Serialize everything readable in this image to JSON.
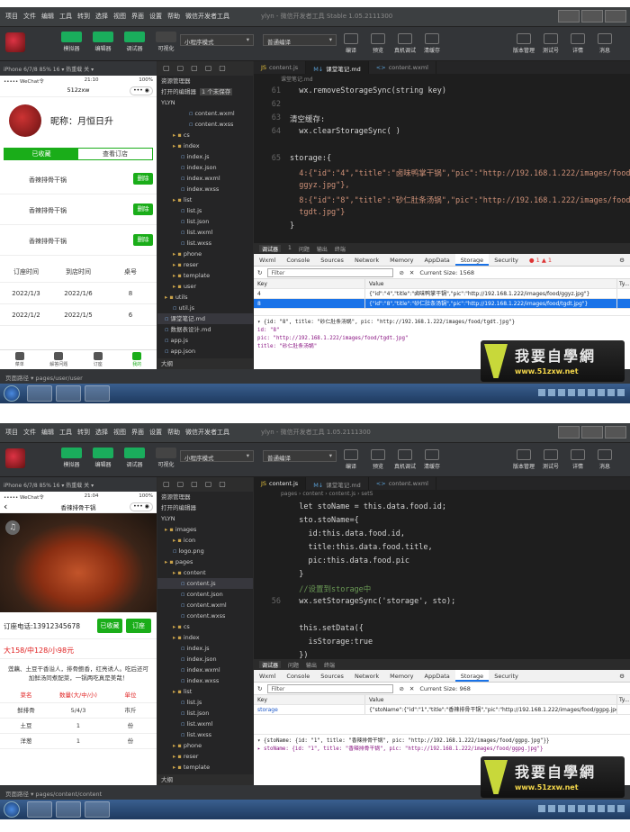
{
  "menu": [
    "项目",
    "文件",
    "编辑",
    "工具",
    "转到",
    "选择",
    "视图",
    "界面",
    "设置",
    "帮助",
    "微信开发者工具"
  ],
  "toolbar": {
    "left": [
      "模拟器",
      "编辑器",
      "调试器",
      "可视化"
    ],
    "mode_select": "小程序模式",
    "compile_select": "普通编译",
    "mid": [
      "编译",
      "预览",
      "真机调试",
      "清缓存"
    ],
    "right": [
      "版本管理",
      "测试号",
      "详情",
      "消息"
    ]
  },
  "screens": [
    {
      "window_title": "ylyn - 微信开发者工具 Stable 1.05.2111300",
      "sim_header": "iPhone 6/7/8 85% 16 ▾    热重载 关 ▾",
      "phone_status": {
        "carrier": "••••• WeChat令",
        "time": "21:10",
        "battery": "100%"
      },
      "nav_title": "512zxw",
      "profile_name": "昵称：月恒日升",
      "profile_tabs": [
        "已收藏",
        "查看订店"
      ],
      "favorites": [
        {
          "name": "香辣排骨干锅",
          "action": "删除"
        },
        {
          "name": "香辣排骨干锅",
          "action": "删除"
        },
        {
          "name": "香辣排骨干锅",
          "action": "删除"
        }
      ],
      "orders_header": [
        "订座时间",
        "到店时间",
        "桌号"
      ],
      "orders": [
        [
          "2022/1/3",
          "2022/1/6",
          "8"
        ],
        [
          "2022/1/2",
          "2022/1/5",
          "6"
        ]
      ],
      "tabbar": [
        "菜单",
        "解答问题",
        "订座",
        "我的"
      ],
      "explorer_head": "资源管理器",
      "explorer_open": "打开的编辑器",
      "explorer_open_badge": "1 个未保存",
      "explorer_project": "YLYN",
      "tree": [
        {
          "name": "content.wxml",
          "indent": 3,
          "type": "file"
        },
        {
          "name": "content.wxss",
          "indent": 3,
          "type": "file"
        },
        {
          "name": "cs",
          "indent": 1,
          "type": "folder"
        },
        {
          "name": "index",
          "indent": 1,
          "type": "folder"
        },
        {
          "name": "index.js",
          "indent": 2,
          "type": "file"
        },
        {
          "name": "index.json",
          "indent": 2,
          "type": "file"
        },
        {
          "name": "index.wxml",
          "indent": 2,
          "type": "file"
        },
        {
          "name": "index.wxss",
          "indent": 2,
          "type": "file"
        },
        {
          "name": "list",
          "indent": 1,
          "type": "folder"
        },
        {
          "name": "list.js",
          "indent": 2,
          "type": "file"
        },
        {
          "name": "list.json",
          "indent": 2,
          "type": "file"
        },
        {
          "name": "list.wxml",
          "indent": 2,
          "type": "file"
        },
        {
          "name": "list.wxss",
          "indent": 2,
          "type": "file"
        },
        {
          "name": "phone",
          "indent": 1,
          "type": "folder"
        },
        {
          "name": "reser",
          "indent": 1,
          "type": "folder"
        },
        {
          "name": "template",
          "indent": 1,
          "type": "folder"
        },
        {
          "name": "user",
          "indent": 1,
          "type": "folder"
        },
        {
          "name": "utils",
          "indent": 0,
          "type": "folder"
        },
        {
          "name": "util.js",
          "indent": 1,
          "type": "file"
        },
        {
          "name": "课堂笔记.md",
          "indent": 0,
          "type": "file",
          "selected": true
        },
        {
          "name": "数据表设计.md",
          "indent": 0,
          "type": "file"
        },
        {
          "name": "app.js",
          "indent": 0,
          "type": "file"
        },
        {
          "name": "app.json",
          "indent": 0,
          "type": "file"
        }
      ],
      "outline": "大纲",
      "editor_tabs": [
        {
          "label": "content.js",
          "icon": "JS",
          "active": false
        },
        {
          "label": "课堂笔记.md",
          "icon": "M↓",
          "active": true
        },
        {
          "label": "content.wxml",
          "icon": "<>",
          "active": false
        }
      ],
      "breadcrumb": "课堂笔记.md",
      "code_start": 61,
      "code": [
        "  wx.removeStorageSync(string key)",
        "",
        "清空缓存:",
        "  wx.clearStorageSync( )",
        "",
        "storage:{",
        "  4:{\"id\":\"4\",\"title\":\"卤味鸭掌干锅\",\"pic\":\"http://192.168.1.222/images/food/",
        "  ggyz.jpg\"},",
        "  8:{\"id\":\"8\",\"title\":\"砂仁肚条汤锅\",\"pic\":\"http://192.168.1.222/images/food/",
        "  tgdt.jpg\"}",
        "}"
      ],
      "code_linenos": [
        "61",
        "62",
        "63",
        "64",
        "",
        "65",
        "",
        "",
        "",
        "",
        ""
      ],
      "dv_top": [
        "调试器",
        "1",
        "问题",
        "输出",
        "终端"
      ],
      "dv_tabs": [
        "Wxml",
        "Console",
        "Sources",
        "Network",
        "Memory",
        "AppData",
        "Storage",
        "Security"
      ],
      "dv_badges": "● 1 ▲ 1",
      "filter_placeholder": "Filter",
      "storage_size": "Current Size: 1568",
      "storage_cols": [
        "Key",
        "Value",
        "Ty..."
      ],
      "storage_rows": [
        {
          "key": "4",
          "value": "{\"id\":\"4\",\"title\":\"卤味鸭掌干锅\",\"pic\":\"http://192.168.1.222/images/food/ggyz.jpg\"}",
          "sel": false
        },
        {
          "key": "8",
          "value": "{\"id\":\"8\",\"title\":\"砂仁肚条汤锅\",\"pic\":\"http://192.168.1.222/images/food/tgdt.jpg\"}",
          "sel": true
        }
      ],
      "detail": [
        "▾ {id: \"8\", title: \"砂仁肚条汤锅\", pic: \"http://192.168.1.222/images/food/tgdt.jpg\"}",
        "    id: \"8\"",
        "    pic: \"http://192.168.1.222/images/food/tgdt.jpg\"",
        "    title: \"砂仁肚条汤锅\""
      ],
      "status_left": "页面路径 ▾    pages/user/user",
      "status_right": "行 65, 列 1    arkdown"
    },
    {
      "window_title": "ylyn - 微信开发者工具 1.05.2111300",
      "sim_header": "iPhone 6/7/8 85% 16 ▾    热重载 关 ▾",
      "phone_status": {
        "carrier": "••••• WeChat令",
        "time": "21:04",
        "battery": "100%"
      },
      "nav_title": "香辣排骨干锅",
      "order_phone": "订座电话:13912345678",
      "order_buttons": [
        "已收藏",
        "订座"
      ],
      "price": "大158/中128/小98元",
      "desc": "莲藕、土豆干香溢人，排骨鲍香，红亮诱人。吃后还可加鲜汤同煮配菜，一锅两吃真是美哉！",
      "ingr_header": [
        "菜名",
        "数量(大/中/小)",
        "单位"
      ],
      "ingr": [
        [
          "鲜排骨",
          "5/4/3",
          "市斤"
        ],
        [
          "土豆",
          "1",
          "份"
        ],
        [
          "洋葱",
          "1",
          "份"
        ]
      ],
      "explorer_head": "资源管理器",
      "explorer_open": "打开的编辑器",
      "explorer_project": "YLYN",
      "tree": [
        {
          "name": "images",
          "indent": 0,
          "type": "folder"
        },
        {
          "name": "icon",
          "indent": 1,
          "type": "folder"
        },
        {
          "name": "logo.png",
          "indent": 1,
          "type": "file"
        },
        {
          "name": "pages",
          "indent": 0,
          "type": "folder"
        },
        {
          "name": "content",
          "indent": 1,
          "type": "folder"
        },
        {
          "name": "content.js",
          "indent": 2,
          "type": "file",
          "selected": true
        },
        {
          "name": "content.json",
          "indent": 2,
          "type": "file"
        },
        {
          "name": "content.wxml",
          "indent": 2,
          "type": "file"
        },
        {
          "name": "content.wxss",
          "indent": 2,
          "type": "file"
        },
        {
          "name": "cs",
          "indent": 1,
          "type": "folder"
        },
        {
          "name": "index",
          "indent": 1,
          "type": "folder"
        },
        {
          "name": "index.js",
          "indent": 2,
          "type": "file"
        },
        {
          "name": "index.json",
          "indent": 2,
          "type": "file"
        },
        {
          "name": "index.wxml",
          "indent": 2,
          "type": "file"
        },
        {
          "name": "index.wxss",
          "indent": 2,
          "type": "file"
        },
        {
          "name": "list",
          "indent": 1,
          "type": "folder"
        },
        {
          "name": "list.js",
          "indent": 2,
          "type": "file"
        },
        {
          "name": "list.json",
          "indent": 2,
          "type": "file"
        },
        {
          "name": "list.wxml",
          "indent": 2,
          "type": "file"
        },
        {
          "name": "list.wxss",
          "indent": 2,
          "type": "file"
        },
        {
          "name": "phone",
          "indent": 1,
          "type": "folder"
        },
        {
          "name": "reser",
          "indent": 1,
          "type": "folder"
        },
        {
          "name": "template",
          "indent": 1,
          "type": "folder"
        }
      ],
      "outline": "大纲",
      "editor_tabs": [
        {
          "label": "content.js",
          "icon": "JS",
          "active": true
        },
        {
          "label": "课堂笔记.md",
          "icon": "M↓",
          "active": false
        },
        {
          "label": "content.wxml",
          "icon": "<>",
          "active": false
        }
      ],
      "breadcrumb": "pages › content › content.js › setS",
      "code_start": 51,
      "code": [
        "  let stoName = this.data.food.id;",
        "  sto.stoName={",
        "    id:this.data.food.id,",
        "    title:this.data.food.title,",
        "    pic:this.data.food.pic",
        "  }",
        "  //设置到storage中",
        "  wx.setStorageSync('storage', sto);",
        "",
        "  this.setData({",
        "    isStorage:true",
        "  })",
        "},",
        "",
        "/**"
      ],
      "code_linenos": [
        "",
        "",
        "",
        "",
        "",
        "",
        "",
        "56",
        "",
        "",
        "",
        "",
        "",
        "",
        ""
      ],
      "dv_top": [
        "调试器",
        "问题",
        "输出",
        "终端"
      ],
      "dv_tabs": [
        "Wxml",
        "Console",
        "Sources",
        "Network",
        "Memory",
        "AppData",
        "Storage",
        "Security"
      ],
      "dv_badges": "",
      "filter_placeholder": "Filter",
      "storage_size": "Current Size: 968",
      "storage_cols": [
        "Key",
        "Value",
        "Ty..."
      ],
      "storage_rows": [
        {
          "key": "storage",
          "value": "{\"stoName\":{\"id\":\"1\",\"title\":\"香辣排骨干锅\",\"pic\":\"http://192.168.1.222/images/food/ggpg.jpg\"}}",
          "sel": false
        }
      ],
      "detail": [
        "▾ {stoName: {id: \"1\", title: \"香辣排骨干锅\", pic: \"http://192.168.1.222/images/food/ggpg.jpg\"}}",
        "  ▸ stoName: {id: \"1\", title: \"香辣排骨干锅\", pic: \"http://192.168.1.222/images/food/ggpg.jpg\"}"
      ],
      "status_left": "页面路径 ▾    pages/content/content",
      "status_right": "avaScript"
    }
  ],
  "watermark": {
    "title": "我要自學網",
    "url": "www.51zxw.net"
  }
}
